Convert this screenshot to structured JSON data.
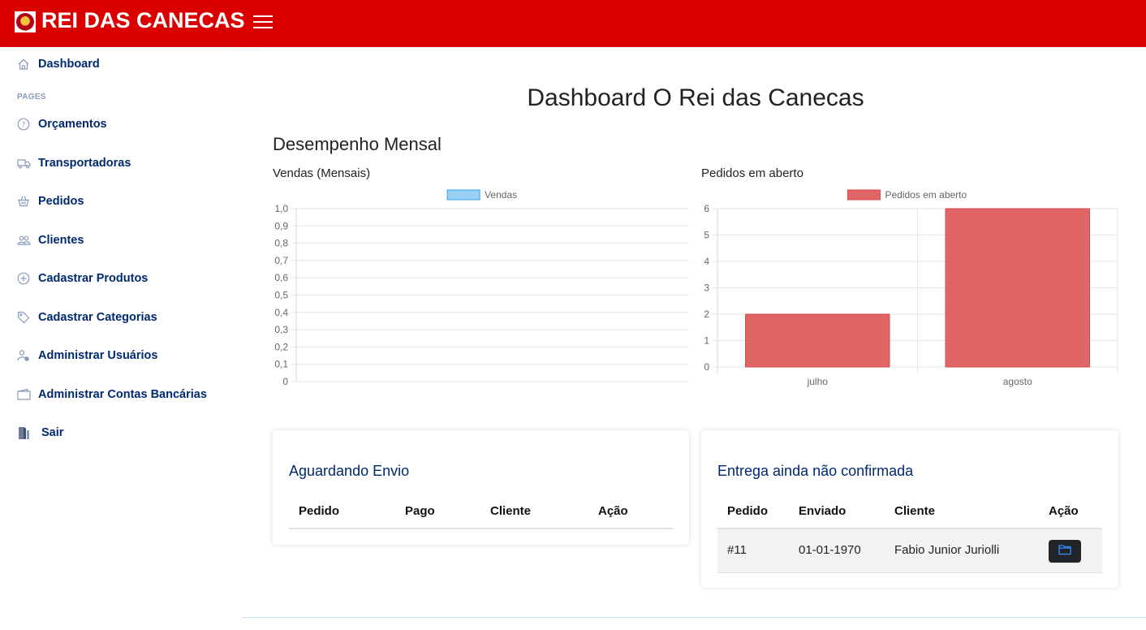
{
  "app": {
    "brand": "REI DAS CANECAS",
    "accent_color": "#db0000"
  },
  "sidebar": {
    "heading": "PAGES",
    "items": [
      {
        "label": "Dashboard",
        "icon": "house-icon"
      },
      {
        "label": "Orçamentos",
        "icon": "question-circle-icon"
      },
      {
        "label": "Transportadoras",
        "icon": "truck-icon"
      },
      {
        "label": "Pedidos",
        "icon": "basket-icon"
      },
      {
        "label": "Clientes",
        "icon": "people-icon"
      },
      {
        "label": "Cadastrar Produtos",
        "icon": "plus-circle-icon"
      },
      {
        "label": "Cadastrar Categorias",
        "icon": "tag-icon"
      },
      {
        "label": "Administrar Usuários",
        "icon": "person-gear-icon"
      },
      {
        "label": "Administrar Contas Bancárias",
        "icon": "wallet-icon"
      },
      {
        "label": "Sair",
        "icon": "door-exit-icon"
      }
    ]
  },
  "main": {
    "title": "Dashboard O Rei das Canecas",
    "section_title": "Desempenho Mensal"
  },
  "chart_data": [
    {
      "type": "bar",
      "title": "Vendas (Mensais)",
      "categories": [],
      "series": [
        {
          "name": "Vendas",
          "values": [],
          "color": "#9ad0f5"
        }
      ],
      "ylim": [
        0,
        1
      ],
      "yticks": [
        "1,0",
        "0,9",
        "0,8",
        "0,7",
        "0,6",
        "0,5",
        "0,4",
        "0,3",
        "0,2",
        "0,1",
        "0"
      ],
      "grid": true,
      "legend": "top-center"
    },
    {
      "type": "bar",
      "title": "Pedidos em aberto",
      "categories": [
        "julho",
        "agosto"
      ],
      "series": [
        {
          "name": "Pedidos em aberto",
          "values": [
            2,
            6
          ],
          "color": "#e06666"
        }
      ],
      "ylim": [
        0,
        6
      ],
      "yticks": [
        "6",
        "5",
        "4",
        "3",
        "2",
        "1",
        "0"
      ],
      "grid": true,
      "legend": "top-center"
    }
  ],
  "cards": {
    "aguardando": {
      "title": "Aguardando Envio",
      "columns": [
        "Pedido",
        "Pago",
        "Cliente",
        "Ação"
      ],
      "rows": []
    },
    "entrega": {
      "title": "Entrega ainda não confirmada",
      "columns": [
        "Pedido",
        "Enviado",
        "Cliente",
        "Ação"
      ],
      "rows": [
        {
          "pedido": "#11",
          "enviado": "01-01-1970",
          "cliente": "Fabio Junior Juriolli",
          "action_icon": "folder-icon"
        }
      ]
    }
  }
}
